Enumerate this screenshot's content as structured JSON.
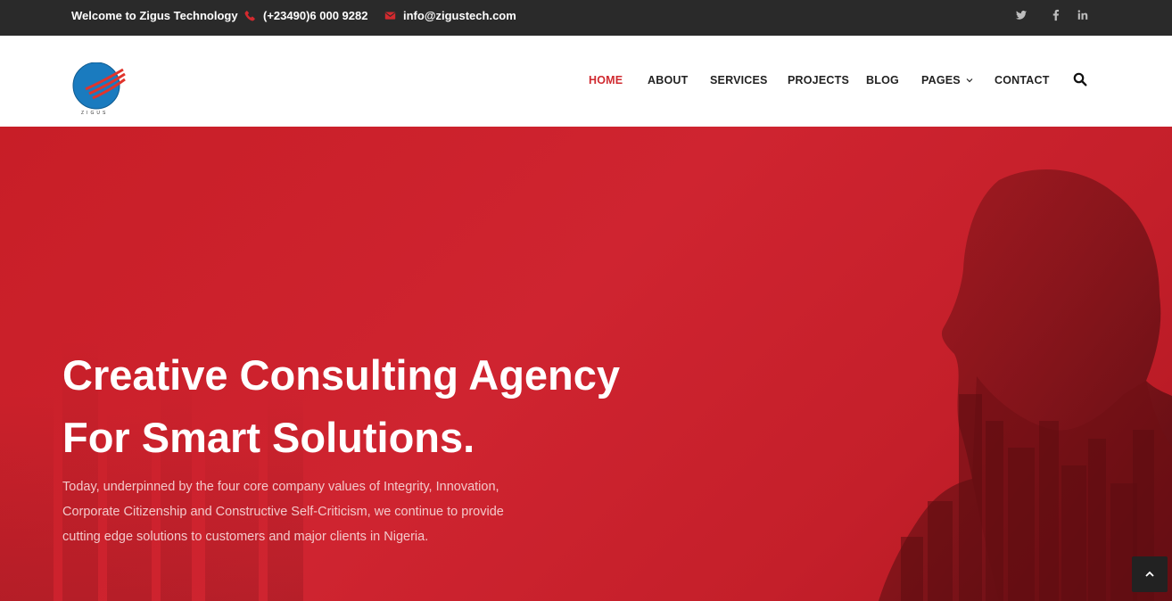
{
  "topbar": {
    "welcome": "Welcome to Zigus Technology",
    "phone": "(+23490)6 000 9282",
    "email": "info@zigustech.com",
    "icons": {
      "phone": "phone-icon",
      "email": "envelope-icon"
    },
    "social": {
      "twitter": "twitter-icon",
      "facebook": "facebook-icon",
      "linkedin": "linkedin-icon"
    },
    "social_text": {
      "twitter": "🐦",
      "facebook": "f",
      "linkedin": "in"
    }
  },
  "header": {
    "logo_text": "ZIGUS",
    "nav": {
      "home": "HOME",
      "about": "ABOUT",
      "services": "SERVICES",
      "projects": "PROJECTS",
      "blog": "BLOG",
      "pages": "PAGES",
      "contact": "CONTACT"
    },
    "active": "HOME"
  },
  "hero": {
    "title_line1": "Creative Consulting Agency",
    "title_line2": "For Smart Solutions.",
    "text_line1": "Today, underpinned by the four core company values of Integrity, Innovation,",
    "text_line2": "Corporate Citizenship and Constructive Self-Criticism, we continue to provide",
    "text_line3": "cutting edge solutions to customers and major clients in Nigeria."
  },
  "colors": {
    "accent": "#d02a30",
    "topbar_bg": "#2a2a2a",
    "hero_bg": "#cf2430"
  }
}
